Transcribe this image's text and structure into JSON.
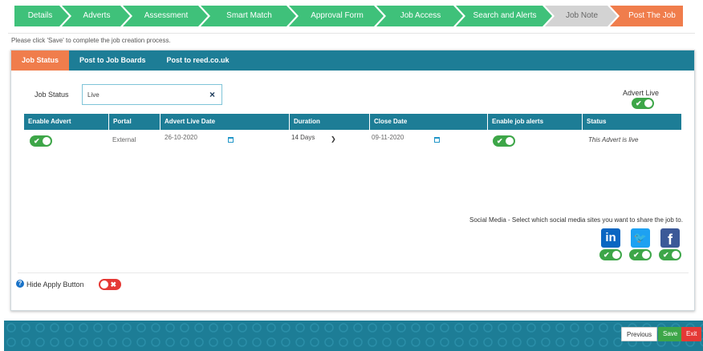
{
  "wizard": {
    "steps": [
      {
        "label": "Details",
        "color": "#3fc17a"
      },
      {
        "label": "Adverts",
        "color": "#3fc17a"
      },
      {
        "label": "Assessment",
        "color": "#3fc17a"
      },
      {
        "label": "Smart Match",
        "color": "#3fc17a"
      },
      {
        "label": "Approval Form",
        "color": "#3fc17a"
      },
      {
        "label": "Job Access",
        "color": "#3fc17a"
      },
      {
        "label": "Search and Alerts",
        "color": "#3fc17a"
      },
      {
        "label": "Job Note",
        "color": "#d3d3d3"
      },
      {
        "label": "Post The Job",
        "color": "#f07d4c"
      }
    ]
  },
  "hint": "Please click 'Save' to complete the job creation process.",
  "tabs": [
    {
      "label": "Job Status",
      "active": true
    },
    {
      "label": "Post to Job Boards",
      "active": false
    },
    {
      "label": "Post to reed.co.uk",
      "active": false
    }
  ],
  "job_status": {
    "label": "Job Status",
    "value": "Live",
    "clear_icon": "×",
    "advert_live_label": "Advert Live",
    "advert_live_on": true
  },
  "table": {
    "headers": [
      "Enable Advert",
      "Portal",
      "Advert Live Date",
      "Duration",
      "Close Date",
      "Enable job alerts",
      "Status"
    ],
    "rows": [
      {
        "enable_advert": true,
        "portal": "External",
        "live_date": "26-10-2020",
        "duration": "14 Days",
        "close_date": "09-11-2020",
        "alerts": true,
        "status": "This Advert is live"
      }
    ]
  },
  "social": {
    "label": "Social Media - Select which social media sites you want to share the job to.",
    "sites": [
      {
        "name": "linkedin-icon",
        "glyph": "in",
        "color": "#0a66c2",
        "on": true
      },
      {
        "name": "twitter-icon",
        "glyph": "🐦",
        "color": "#1da1f2",
        "on": true
      },
      {
        "name": "facebook-icon",
        "glyph": "f",
        "color": "#3b5998",
        "on": true
      }
    ]
  },
  "hide_apply": {
    "label": "Hide Apply Button",
    "help_glyph": "?",
    "on": false
  },
  "footer": {
    "previous": "Previous",
    "save": "Save",
    "exit": "Exit"
  }
}
